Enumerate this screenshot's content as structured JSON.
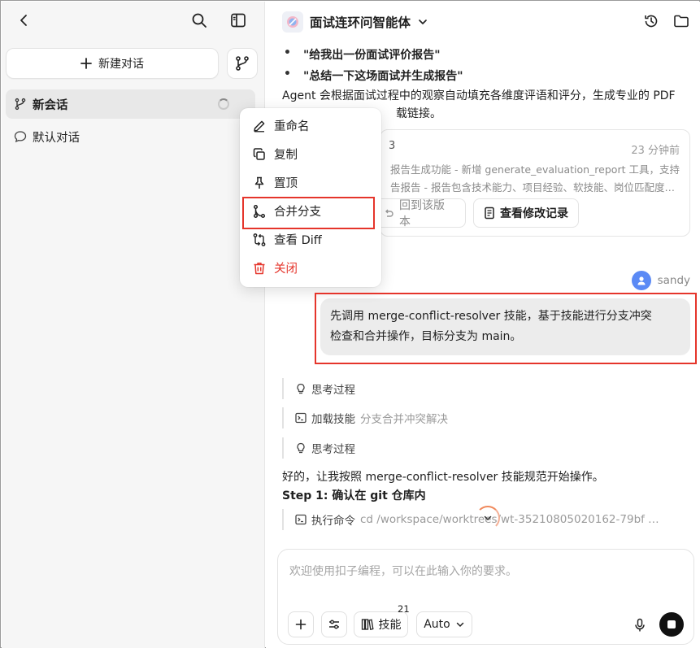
{
  "sidebar": {
    "new_chat_label": "新建对话",
    "conversations": [
      {
        "label": "新会话"
      },
      {
        "label": "默认对话"
      }
    ]
  },
  "context_menu": {
    "items": [
      {
        "label": "重命名",
        "icon": "pencil-icon"
      },
      {
        "label": "复制",
        "icon": "copy-icon"
      },
      {
        "label": "置顶",
        "icon": "pin-icon"
      },
      {
        "label": "合并分支",
        "icon": "merge-icon"
      },
      {
        "label": "查看 Diff",
        "icon": "diff-icon"
      },
      {
        "label": "关闭",
        "icon": "trash-icon"
      }
    ],
    "danger_color": "#e5352b"
  },
  "header": {
    "agent_name": "面试连环问智能体"
  },
  "chat": {
    "bullets": [
      "\"给我出一份面试评价报告\"",
      "\"总结一下这场面试并生成报告\""
    ],
    "para_line1": "Agent 会根据面试过程中的观察自动填充各维度评语和评分，生成专业的 PDF",
    "para_line2": "载链接。",
    "card": {
      "title_tail": "3",
      "time": "23 分钟前",
      "line1": "报告生成功能 - 新增 generate_evaluation_report 工具，支持",
      "line2": "告报告 - 报告包含技术能力、项目经验、软技能、岗位匹配度…",
      "revert_label": "回到该版本",
      "history_label": "查看修改记录"
    },
    "user_name": "sandy",
    "user_message_line1": "先调用 merge-conflict-resolver 技能，基于技能进行分支冲突",
    "user_message_line2": "检查和合并操作，目标分支为 main。",
    "steps": [
      {
        "label": "思考过程",
        "detail": ""
      },
      {
        "label": "加载技能",
        "detail": "分支合并冲突解决"
      },
      {
        "label": "思考过程",
        "detail": ""
      }
    ],
    "reply_line": "好的，让我按照 merge-conflict-resolver 技能规范开始操作。",
    "step_heading": "Step 1: 确认在 git 仓库内",
    "exec_step": {
      "label": "执行命令",
      "detail": "cd /workspace/worktrees/wt-35210805020162-79bf …"
    }
  },
  "composer": {
    "placeholder": "欢迎使用扣子编程，可以在此输入你的要求。",
    "skills_label": "技能",
    "skills_count": "21",
    "mode_label": "Auto"
  }
}
